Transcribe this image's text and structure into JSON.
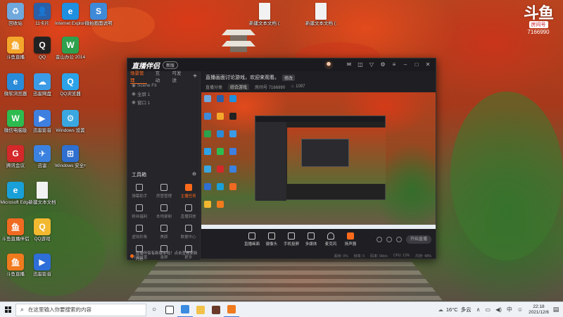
{
  "desktop": {
    "icons": [
      {
        "label": "回收站",
        "color": "#6fa8dc",
        "glyph": "♻"
      },
      {
        "label": "11卡片",
        "color": "#2b5fa8",
        "glyph": "👤"
      },
      {
        "label": "Internet Explorer",
        "color": "#1f8fe0",
        "glyph": "e"
      },
      {
        "label": "微拍画面说明",
        "color": "#3e8ad8",
        "glyph": "S"
      },
      {
        "label": "新建文本文档 (2)",
        "color": "#f2f2f2",
        "glyph": ""
      },
      {
        "label": "新建文本文档 (3)",
        "color": "#f2f2f2",
        "glyph": ""
      },
      {
        "label": "斗鱼直播",
        "color": "#f4a72a",
        "glyph": "鱼"
      },
      {
        "label": "QQ",
        "color": "#222222",
        "glyph": "Q"
      },
      {
        "label": "金山办公 2014",
        "color": "#2ea14e",
        "glyph": "W"
      },
      {
        "label": "微软浏览器",
        "color": "#2a8bd8",
        "glyph": "e"
      },
      {
        "label": "迅雷网盘",
        "color": "#3c9be6",
        "glyph": "☁"
      },
      {
        "label": "QQ浏览器",
        "color": "#2ca3e8",
        "glyph": "Q"
      },
      {
        "label": "微信电脑版",
        "color": "#2dbb4f",
        "glyph": "W"
      },
      {
        "label": "迅雷影音",
        "color": "#3f7fe0",
        "glyph": "▶"
      },
      {
        "label": "Windows 设置",
        "color": "#3aa7e0",
        "glyph": "⚙"
      },
      {
        "label": "腾讯会议",
        "color": "#d4282a",
        "glyph": "G"
      },
      {
        "label": "迅雷",
        "color": "#3b82e0",
        "glyph": "✈"
      },
      {
        "label": "Windows 安全中心",
        "color": "#2e6fd0",
        "glyph": "⊞"
      },
      {
        "label": "Microsoft Edge",
        "color": "#1aa0d8",
        "glyph": "e"
      },
      {
        "label": "新建文本文档",
        "color": "#f2f2f2",
        "glyph": ""
      },
      {
        "label": "斗鱼直播伴侣",
        "color": "#f06a22",
        "glyph": "鱼"
      },
      {
        "label": "QQ游戏",
        "color": "#f2b830",
        "glyph": "Q"
      },
      {
        "label": "斗鱼直播",
        "color": "#f07a1e",
        "glyph": "鱼"
      },
      {
        "label": "迅雷影音",
        "color": "#2d6ed8",
        "glyph": "▶"
      }
    ]
  },
  "brand": {
    "logo": "斗鱼",
    "sub": "房间号",
    "room_id": "7166990"
  },
  "app": {
    "title": "直播伴侣",
    "version": "新版",
    "side_tabs": [
      "场景管理",
      "互动",
      "可发送"
    ],
    "scene_rows": [
      "Scene Fit",
      "全屏 1",
      "窗口 1"
    ],
    "tools_title": "工具箱",
    "tools": [
      {
        "label": "弹幕助手",
        "hot": false
      },
      {
        "label": "房管管理",
        "hot": false
      },
      {
        "label": "主播任务",
        "hot": true
      },
      {
        "label": "粉丝福利",
        "hot": false
      },
      {
        "label": "本地录制",
        "hot": false
      },
      {
        "label": "直播回放",
        "hot": false
      },
      {
        "label": "虚拟形象",
        "hot": false
      },
      {
        "label": "美颜",
        "hot": false
      },
      {
        "label": "数据中心",
        "hot": false
      },
      {
        "label": "开播设置",
        "hot": false
      },
      {
        "label": "录屏",
        "hot": false
      },
      {
        "label": "更多",
        "hot": false
      }
    ],
    "room_title": "直播画面讨论游戏，欢迎来观看。",
    "edit_label": "修改",
    "room_meta": [
      "直播分类",
      "综合游戏",
      "房间号 7166990",
      "♨ 1097"
    ],
    "controls": [
      {
        "label": "直播画面",
        "type": "plain"
      },
      {
        "label": "摄像头",
        "type": "plain"
      },
      {
        "label": "手机投屏",
        "type": "plain"
      },
      {
        "label": "多媒体",
        "type": "plain"
      },
      {
        "label": "麦克风",
        "type": "mic"
      },
      {
        "label": "扬声器",
        "type": "spk"
      }
    ],
    "start_label": "开始直播",
    "stats": [
      "丢帧: 0%",
      "帧率: 0",
      "码率: 0kb/s",
      "CPU: 13%",
      "内存: 48%"
    ],
    "status": "直播伴侣有新版本啦！点击查看更新内容"
  },
  "taskbar": {
    "search_placeholder": "在这里输入你要搜索的内容",
    "temperature": "16°C",
    "weather": "多云",
    "ime": "中",
    "time": "22:18",
    "date": "2021/12/6"
  }
}
